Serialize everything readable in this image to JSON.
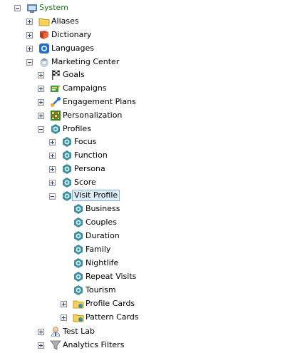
{
  "tree": {
    "system": "System",
    "aliases": "Aliases",
    "dictionary": "Dictionary",
    "languages": "Languages",
    "marketing_center": "Marketing Center",
    "goals": "Goals",
    "campaigns": "Campaigns",
    "engagement_plans": "Engagement Plans",
    "personalization": "Personalization",
    "profiles": "Profiles",
    "focus": "Focus",
    "function": "Function",
    "persona": "Persona",
    "score": "Score",
    "visit_profile": "Visit Profile",
    "business": "Business",
    "couples": "Couples",
    "duration": "Duration",
    "family": "Family",
    "nightlife": "Nightlife",
    "repeat_visits": "Repeat Visits",
    "tourism": "Tourism",
    "profile_cards": "Profile Cards",
    "pattern_cards": "Pattern Cards",
    "test_lab": "Test Lab",
    "analytics_filters": "Analytics Filters"
  },
  "icons": {
    "system": "system-icon",
    "folder": "folder-icon",
    "dictionary": "dictionary-book-icon",
    "languages": "globe-icon",
    "marketing_center": "marketing-center-icon",
    "goals": "flag-icon",
    "campaigns": "campaign-icon",
    "engagement_plans": "engagement-plan-icon",
    "personalization": "personalization-grid-icon",
    "profile": "profile-gear-icon",
    "test_lab": "test-lab-person-icon",
    "analytics_filters": "funnel-icon"
  },
  "colors": {
    "root_label": "#1a7a1a",
    "selected_bg": "#dff0fb",
    "selected_border": "#7fb3d8"
  }
}
